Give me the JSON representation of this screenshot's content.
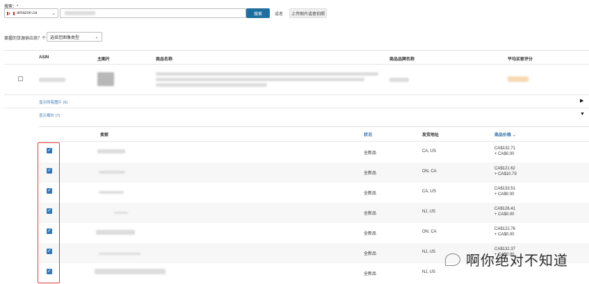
{
  "search": {
    "label": "搜索：",
    "required_mark": "*",
    "marketplace": "amazon.ca",
    "button": "搜索",
    "or_text": "或者",
    "upload_button": "上传图片或者拍照"
  },
  "filter": {
    "label": "掌握的货源供应商？个：",
    "type_select": "选择您图像类型"
  },
  "table": {
    "headers": [
      "ASIN",
      "主图片",
      "商品名称",
      "商品品牌名称",
      "平均买家评分"
    ],
    "show_all_images_link": "显示所有图片 (6)",
    "show_offers_link": "显示报价 (7)"
  },
  "offers": {
    "headers": [
      "卖家",
      "状况",
      "发货地址",
      "商品价格"
    ],
    "sort_icon": "chevron-down-icon",
    "rows": [
      {
        "condition": "全新品",
        "ship_from": "CA, US",
        "price": "CA$132.71",
        "shipping": "+ CA$0.00"
      },
      {
        "condition": "全新品",
        "ship_from": "ON, CA",
        "price": "CA$121.62",
        "shipping": "+ CA$10.79"
      },
      {
        "condition": "全新品",
        "ship_from": "CA, US",
        "price": "CA$133.51",
        "shipping": "+ CA$0.00"
      },
      {
        "condition": "全新品",
        "ship_from": "NJ, US",
        "price": "CA$126.41",
        "shipping": "+ CA$0.00"
      },
      {
        "condition": "全新品",
        "ship_from": "ON, CA",
        "price": "CA$122.76",
        "shipping": "+ CA$0.00"
      },
      {
        "condition": "全新品",
        "ship_from": "NJ, US",
        "price": "CA$132.37",
        "shipping": "+ CA$0.00"
      },
      {
        "condition": "全新品",
        "ship_from": "NJ, US",
        "price": "",
        "shipping": ""
      }
    ]
  },
  "watermark": {
    "text": "啊你绝对不知道"
  },
  "colors": {
    "accent": "#2f79c2",
    "search_button": "#1e6e9f",
    "highlight": "#e53935"
  }
}
